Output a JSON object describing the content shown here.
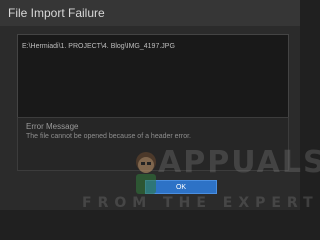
{
  "window": {
    "title": "File Import Failure"
  },
  "files": [
    "E:\\Hermiadi\\1. PROJECT\\4. Blog\\IMG_4197.JPG"
  ],
  "error": {
    "label": "Error Message",
    "text": "The file cannot be opened because of a header error."
  },
  "buttons": {
    "ok": "OK"
  },
  "watermark": {
    "top": "APPUALS",
    "bottom": "FROM THE EXPERT"
  },
  "colors": {
    "accent": "#2d72c6",
    "background": "#2b2b2b"
  }
}
